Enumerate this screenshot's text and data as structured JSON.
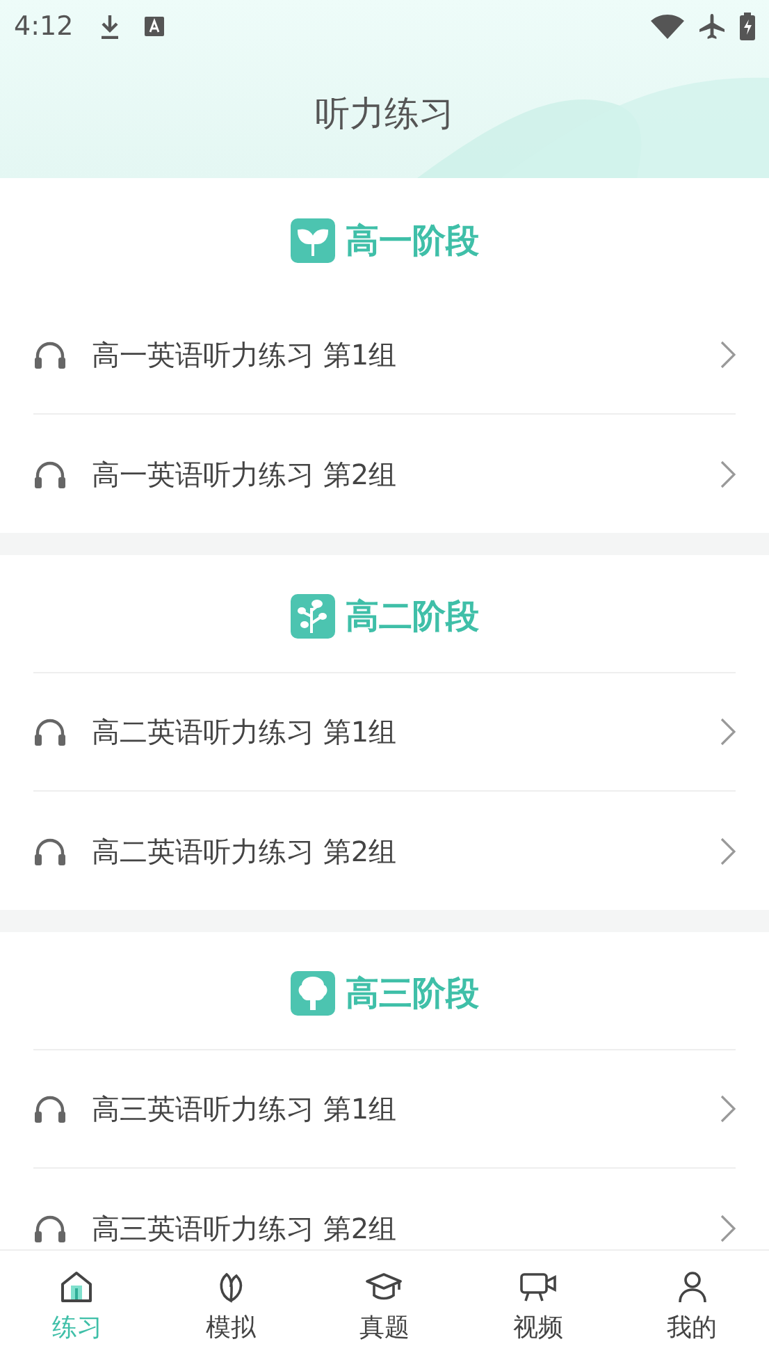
{
  "status_bar": {
    "time": "4:12"
  },
  "header": {
    "title": "听力练习"
  },
  "sections": [
    {
      "title": "高一阶段",
      "items": [
        {
          "label": "高一英语听力练习 第1组"
        },
        {
          "label": "高一英语听力练习 第2组"
        }
      ]
    },
    {
      "title": "高二阶段",
      "items": [
        {
          "label": "高二英语听力练习 第1组"
        },
        {
          "label": "高二英语听力练习 第2组"
        }
      ]
    },
    {
      "title": "高三阶段",
      "items": [
        {
          "label": "高三英语听力练习 第1组"
        },
        {
          "label": "高三英语听力练习 第2组"
        }
      ]
    }
  ],
  "bottom_nav": [
    {
      "label": "练习",
      "selected": true
    },
    {
      "label": "模拟",
      "selected": false
    },
    {
      "label": "真题",
      "selected": false
    },
    {
      "label": "视频",
      "selected": false
    },
    {
      "label": "我的",
      "selected": false
    }
  ]
}
